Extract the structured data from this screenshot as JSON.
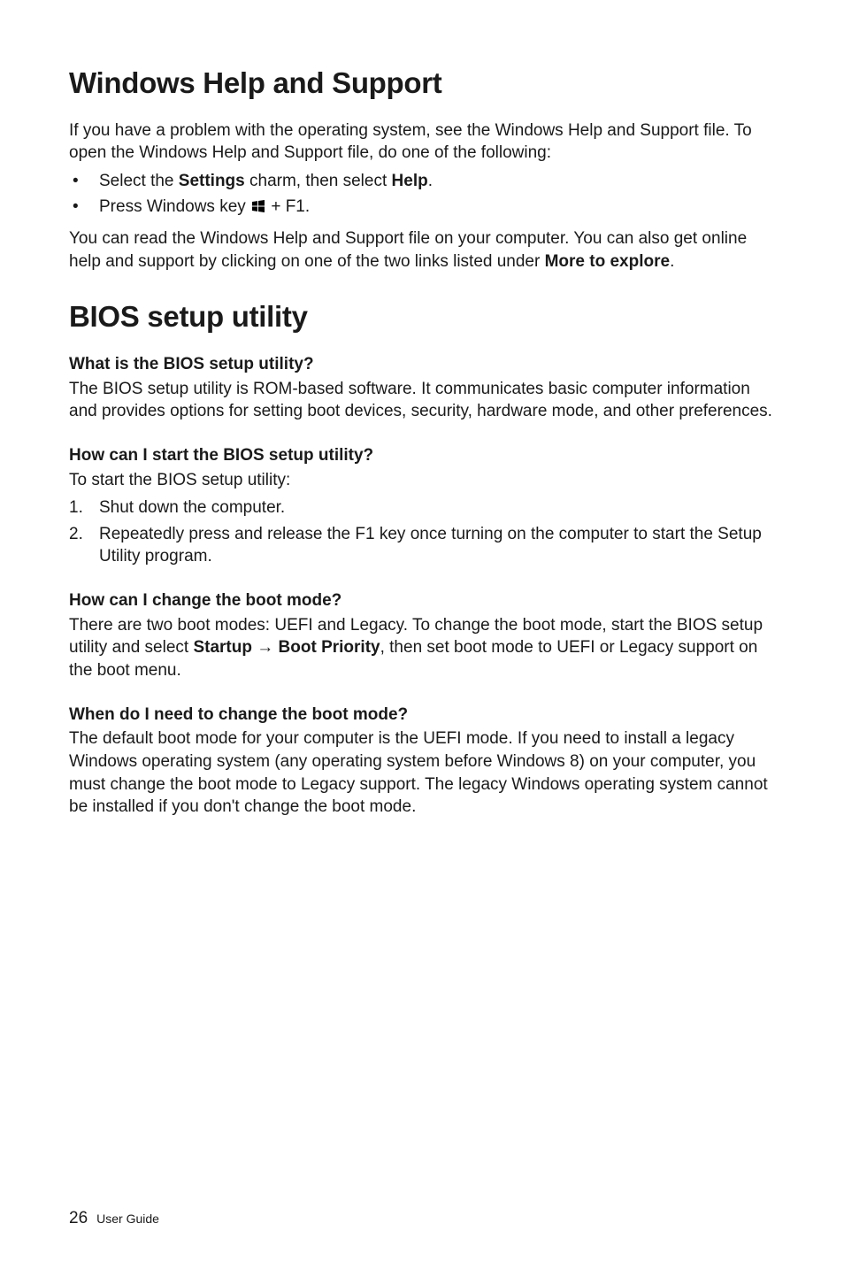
{
  "section1": {
    "title": "Windows Help and Support",
    "intro": "If you have a problem with the operating system, see the Windows Help and Support file. To open the Windows Help and Support file, do one of the following:",
    "bullets": {
      "b1": {
        "pre": "Select the ",
        "bold1": "Settings",
        "mid": " charm, then select ",
        "bold2": "Help",
        "post": "."
      },
      "b2": {
        "pre": "Press Windows key ",
        "post": " + F1."
      }
    },
    "after": {
      "pre": "You can read the Windows Help and Support file on your computer. You can also get online help and support by clicking on one of the two links listed under ",
      "bold": "More to explore",
      "post": "."
    }
  },
  "section2": {
    "title": "BIOS setup utility",
    "q1": {
      "heading": "What is the BIOS setup utility?",
      "body": "The BIOS setup utility is ROM-based software. It communicates basic computer information and provides options for setting boot devices, security, hardware mode, and other preferences."
    },
    "q2": {
      "heading": "How can I start the BIOS setup utility?",
      "body": "To start the BIOS setup utility:",
      "steps": {
        "s1": "Shut down the computer.",
        "s2": "Repeatedly press and release the F1 key once turning on the computer to start the Setup Utility program."
      }
    },
    "q3": {
      "heading": "How can I change the boot mode?",
      "body": {
        "pre": "There are two boot modes: UEFI and Legacy. To change the boot mode, start the BIOS setup utility and select ",
        "bold1": "Startup",
        "arrow": " → ",
        "bold2": "Boot Priority",
        "post": ", then set boot mode to UEFI or Legacy support on the boot menu."
      }
    },
    "q4": {
      "heading": "When do I need to change the boot mode?",
      "body": "The default boot mode for your computer is the UEFI mode. If you need to install a legacy Windows operating system (any operating system before Windows 8) on your computer, you must change the boot mode to Legacy support. The legacy Windows operating system cannot be installed if you don't change the boot mode."
    }
  },
  "footer": {
    "page_number": "26",
    "guide_label": "User Guide"
  }
}
